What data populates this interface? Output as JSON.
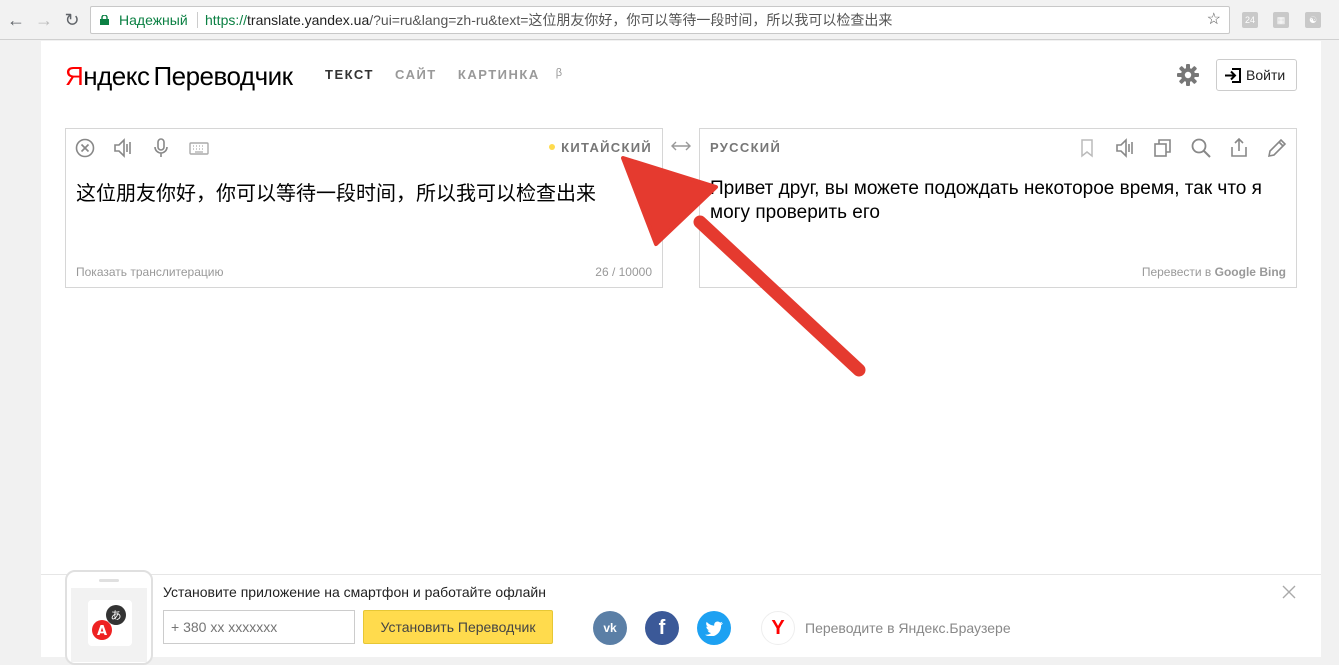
{
  "browser": {
    "secure_label": "Надежный",
    "url_prefix": "https://",
    "url_host": "translate.yandex.ua",
    "url_rest": "/?ui=ru&lang=zh-ru&text=这位朋友你好，你可以等待一段时间，所以我可以检查出来",
    "ext_badge": "24"
  },
  "header": {
    "logo_brand_red": "Я",
    "logo_brand_rest": "ндекс",
    "logo_product": "Переводчик",
    "tabs": [
      {
        "label": "ТЕКСТ",
        "active": true
      },
      {
        "label": "САЙТ",
        "active": false
      },
      {
        "label": "КАРТИНКА",
        "active": false
      }
    ],
    "beta": "β",
    "login_label": "Войти"
  },
  "source": {
    "language": "КИТАЙСКИЙ",
    "text": "这位朋友你好，你可以等待一段时间，所以我可以检查出来",
    "translit_link": "Показать транслитерацию",
    "counter": "26 / 10000"
  },
  "target": {
    "language": "РУССКИЙ",
    "text": "Привет друг, вы можете подождать некоторое время, так что я могу проверить его",
    "translate_in": "Перевести в",
    "engine_google": "Google",
    "engine_bing": "Bing"
  },
  "promo": {
    "title": "Установите приложение на смартфон и работайте офлайн",
    "phone_placeholder": "+ 380 xx xxxxxxx",
    "install_label": "Установить Переводчик",
    "vk": "vk",
    "fb": "f",
    "browser_text": "Переводите в Яндекс.Браузере"
  },
  "colors": {
    "accent_yellow": "#ffdb4d",
    "brand_red": "#ff0000",
    "annotation_arrow": "#e53a2f"
  }
}
